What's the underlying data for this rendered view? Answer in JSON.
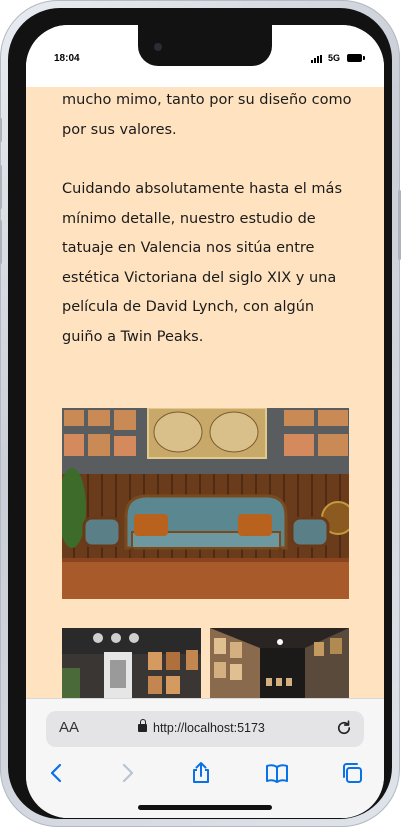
{
  "status_bar": {
    "time": "18:04",
    "network": "5G"
  },
  "article": {
    "paragraph1": "mucho mimo, tanto por su diseño como por sus valores.",
    "paragraph2": "Cuidando absolutamente hasta el más mínimo detalle, nuestro estudio de tatuaje en Valencia nos sitúa entre estética Victoriana del siglo XIX y una película de David Lynch, con algún guiño a Twin Peaks."
  },
  "browser": {
    "text_size_label": "AA",
    "url": "http://localhost:5173"
  },
  "toolbar": {
    "icons": [
      "back-icon",
      "forward-icon",
      "share-icon",
      "bookmarks-icon",
      "tabs-icon"
    ]
  },
  "colors": {
    "page_background": "#ffe3c1",
    "accent": "#0a72e6"
  }
}
